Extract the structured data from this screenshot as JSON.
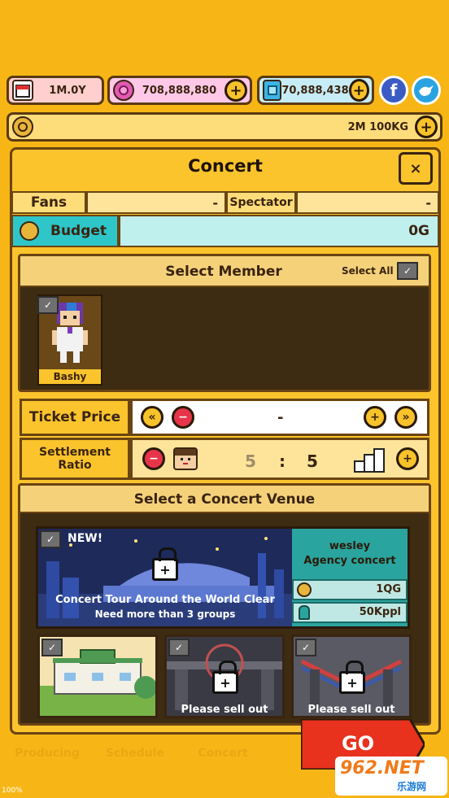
{
  "status_bar": {
    "date": "1M.0Y",
    "gems": "708,888,880",
    "diamonds": "70,888,438",
    "money": "2M 100KG"
  },
  "icons": {
    "calendar": "calendar-icon",
    "gem": "pink-gem-icon",
    "diamond": "blue-diamond-icon",
    "coin": "coin-icon",
    "facebook": "facebook-icon",
    "bird": "bird-icon"
  },
  "concert": {
    "title": "Concert",
    "close_label": "×",
    "fans_label": "Fans",
    "fans_value": "-",
    "spectator_label": "Spectator",
    "spectator_value": "-",
    "budget_label": "Budget",
    "budget_value": "0G",
    "select_member_label": "Select Member",
    "select_all_label": "Select All",
    "members": [
      {
        "name": "Bashy"
      }
    ],
    "ticket_price_label": "Ticket Price",
    "ticket_price_value": "-",
    "settlement_label_1": "Settlement",
    "settlement_label_2": "Ratio",
    "ratio_left": "5",
    "ratio_sep": ":",
    "ratio_right": "5",
    "select_venue_label": "Select a Concert Venue",
    "venues": {
      "main": {
        "badge": "NEW!",
        "caption_1": "Concert Tour Around the World Clear",
        "caption_2": "Need more than 3 groups",
        "name_1": "wesley",
        "name_2": "Agency concert",
        "cost": "1QG",
        "fans": "50Kppl"
      },
      "small": [
        {
          "caption": ""
        },
        {
          "caption": "Please sell out"
        },
        {
          "caption": "Please sell out"
        }
      ]
    },
    "go_label": "GO"
  },
  "bottom_tabs": [
    "Producing",
    "Schedule",
    "Concert"
  ],
  "footer": {
    "percent": "100%",
    "watermark_logo": "962.NET",
    "watermark_sub": "乐游网"
  },
  "colors": {
    "background": "#f7b616",
    "panel": "#fbc42c",
    "budget_teal": "#2ec6c9",
    "go_red": "#e8321e",
    "dark_brown": "#3a2410"
  }
}
